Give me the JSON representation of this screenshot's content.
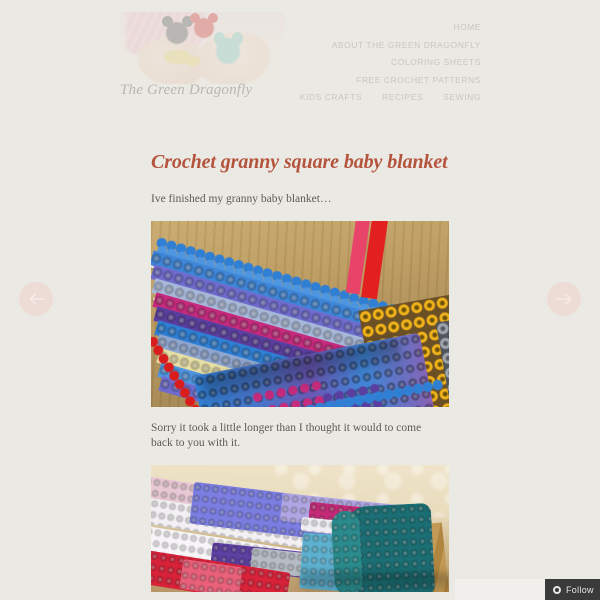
{
  "site": {
    "title": "The Green Dragonfly",
    "header_image_alt": "child hands holding small crocheted animals"
  },
  "nav": {
    "rows": [
      [
        "HOME"
      ],
      [
        "ABOUT THE GREEN DRAGONFLY"
      ],
      [
        "COLORING SHEETS"
      ],
      [
        "FREE CROCHET PATTERNS"
      ],
      [
        "KIDS CRAFTS",
        "RECIPES",
        "SEWING"
      ]
    ]
  },
  "carousel": {
    "prev_label": "Previous",
    "next_label": "Next",
    "prev_icon": "arrow-left-icon",
    "next_icon": "arrow-right-icon",
    "circle_color": "#eddbd6"
  },
  "post": {
    "title": "Crochet granny square baby blanket",
    "title_color": "#b4543d",
    "paragraph_1": "Ive finished my granny baby blanket…",
    "paragraph_2": "Sorry it took a little longer than I thought it would to come back to you with it.",
    "image_1_alt": "Blue, pink, purple and yellow granny square blanket on a wooden table with knitting needles",
    "image_2_alt": "Folded granny square baby blanket in purple, teal, white, pink and red"
  },
  "follow": {
    "label": "Follow",
    "icon": "wordpress-follow-icon",
    "background": "#3a3a3a"
  },
  "theme": {
    "page_background": "#ebe9e4",
    "nav_text": "#c9c6bf",
    "body_text": "#5c5a56",
    "site_title_color": "#b9b6b0"
  }
}
